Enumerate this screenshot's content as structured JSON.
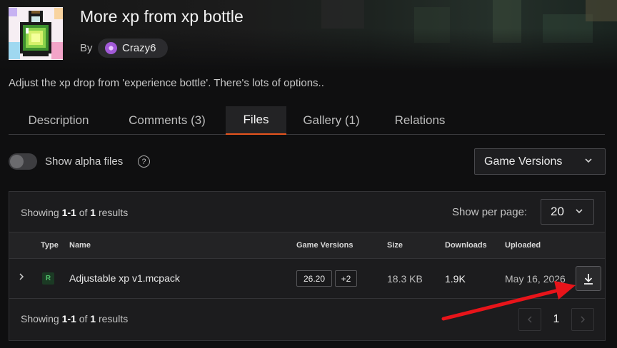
{
  "project": {
    "title": "More xp from xp bottle",
    "by_label": "By",
    "author": "Crazy6",
    "summary": "Adjust the xp drop from 'experience bottle'. There's lots of options.."
  },
  "tabs": [
    {
      "label": "Description",
      "active": false
    },
    {
      "label": "Comments (3)",
      "active": false
    },
    {
      "label": "Files",
      "active": true
    },
    {
      "label": "Gallery (1)",
      "active": false
    },
    {
      "label": "Relations",
      "active": false
    }
  ],
  "filters": {
    "alpha_label": "Show alpha files",
    "alpha_enabled": false,
    "help_glyph": "?",
    "game_versions_label": "Game Versions"
  },
  "results": {
    "showing_prefix": "Showing",
    "range": "1-1",
    "of": "of",
    "total": "1",
    "suffix": "results",
    "per_page_label": "Show per page:",
    "per_page_value": "20"
  },
  "table": {
    "headers": {
      "type": "Type",
      "name": "Name",
      "game_versions": "Game Versions",
      "size": "Size",
      "downloads": "Downloads",
      "uploaded": "Uploaded"
    },
    "rows": [
      {
        "type_badge": "R",
        "name": "Adjustable xp v1.mcpack",
        "version": "26.20",
        "more_versions": "+2",
        "size": "18.3 KB",
        "downloads": "1.9K",
        "uploaded": "May 16, 2026"
      }
    ]
  },
  "pagination": {
    "current_page": "1"
  },
  "colors": {
    "accent": "#e8551e",
    "annotation_arrow": "#e8141a",
    "release_badge": "#4fbf6a"
  },
  "icons": {
    "help": "help-circle-icon",
    "dropdown": "chevron-down-icon",
    "expand": "chevron-right-icon",
    "download": "download-icon",
    "prev": "chevron-left-icon",
    "next": "chevron-right-icon"
  }
}
